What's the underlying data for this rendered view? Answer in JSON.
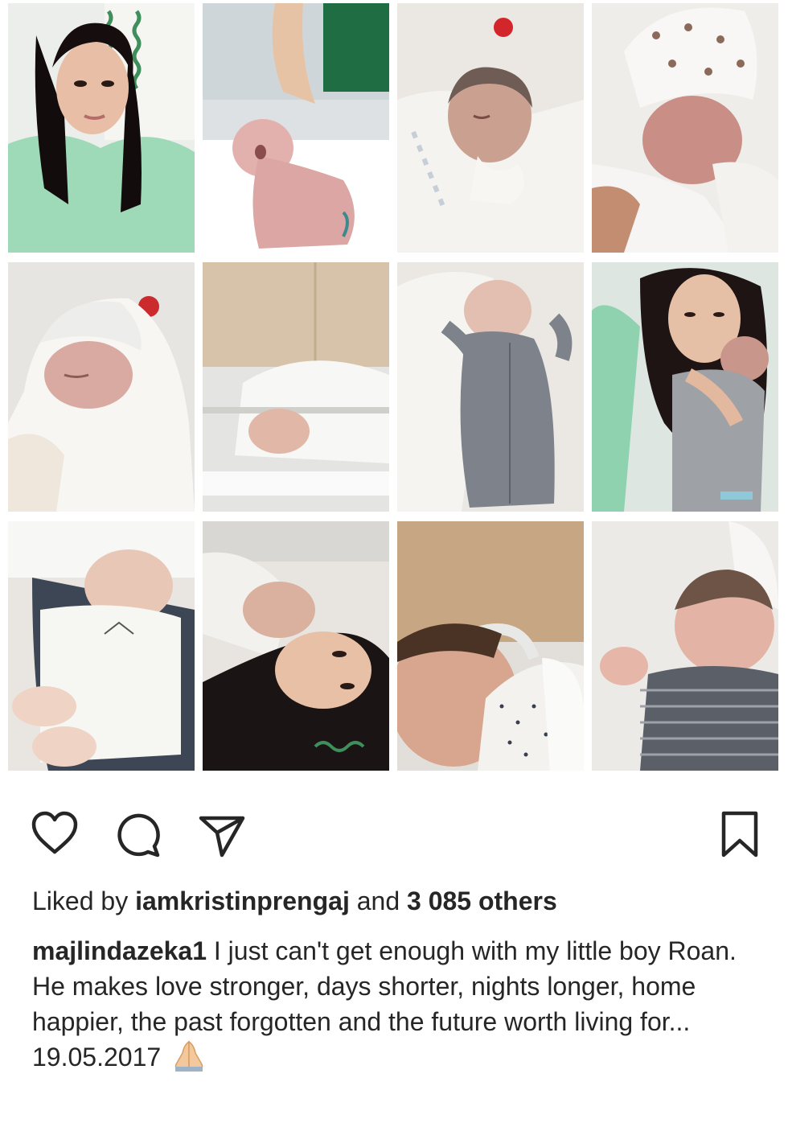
{
  "post": {
    "photos": [
      {
        "name": "photo-mother-selfie-hospital-bed",
        "bg": "#e7eae6",
        "accent": "#8fd1b0"
      },
      {
        "name": "photo-newborn-after-birth",
        "bg": "#dcdfe2",
        "accent": "#d9aaa8"
      },
      {
        "name": "photo-newborn-wrapped-blanket",
        "bg": "#ece9e4",
        "accent": "#c79a8c"
      },
      {
        "name": "photo-newborn-in-hat",
        "bg": "#eeece8",
        "accent": "#c8928a"
      },
      {
        "name": "photo-newborn-swaddled-hat",
        "bg": "#e8e6e3",
        "accent": "#d7a9a0"
      },
      {
        "name": "photo-newborn-in-bassinet",
        "bg": "#d8c5ab",
        "accent": "#f3f3f3"
      },
      {
        "name": "photo-newborn-grey-onesie",
        "bg": "#e7e4df",
        "accent": "#7f848c"
      },
      {
        "name": "photo-mother-holding-baby",
        "bg": "#d9e6e0",
        "accent": "#2a1d1b"
      },
      {
        "name": "photo-newborn-sleeping-white-onesie",
        "bg": "#e9e6e1",
        "accent": "#404855"
      },
      {
        "name": "photo-mother-lying-with-baby",
        "bg": "#e6e2dd",
        "accent": "#1d1616"
      },
      {
        "name": "photo-newborn-close-up",
        "bg": "#c9aa86",
        "accent": "#f1efec"
      },
      {
        "name": "photo-newborn-striped-outfit",
        "bg": "#eceae7",
        "accent": "#575c66"
      }
    ]
  },
  "actions": {
    "like_icon": "heart-icon",
    "comment_icon": "comment-icon",
    "share_icon": "paper-plane-icon",
    "save_icon": "bookmark-icon"
  },
  "likes": {
    "prefix": "Liked by",
    "user": "iamkristinprengaj",
    "joiner": "and",
    "others": "3 085 others"
  },
  "caption": {
    "username": "majlindazeka1",
    "line1": "I just can't get enough with my little boy Roan.",
    "line2": "He makes love stronger, days shorter, nights longer, home happier, the past forgotten and the future worth living for... 19.05.2017",
    "emoji_icon": "folded-hands-icon"
  },
  "colors": {
    "text": "#262626",
    "icon_stroke": "#262626"
  }
}
